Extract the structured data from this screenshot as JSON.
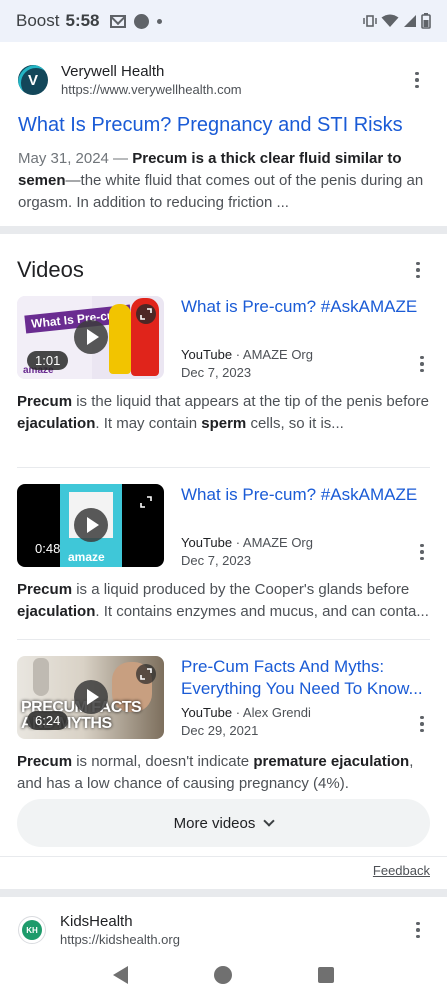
{
  "status_bar": {
    "carrier": "Boost",
    "time": "5:58",
    "icons_left": [
      "gmail-icon",
      "dot-icon",
      "small-dot-icon"
    ],
    "icons_right": [
      "vibrate-icon",
      "wifi-icon",
      "signal-icon",
      "battery-icon"
    ]
  },
  "result": {
    "site_name": "Verywell Health",
    "site_url": "https://www.verywellhealth.com",
    "logo_letter": "V",
    "title": "What Is Precum? Pregnancy and STI Risks",
    "date": "May 31, 2024 — ",
    "snippet_bold": "Precum is a thick clear fluid similar to semen",
    "snippet_rest": "—the white fluid that comes out of the penis during an orgasm. In addition to reducing friction ..."
  },
  "videos": {
    "heading": "Videos",
    "items": [
      {
        "title": "What is Pre-cum? #AskAMAZE",
        "duration": "1:01",
        "thumb_text": "What Is Pre-cum",
        "thumb_brand": "amaze",
        "source": "YouTube",
        "channel": " · AMAZE Org",
        "date": "Dec 7, 2023",
        "desc_parts": [
          "Precum",
          " is the liquid that appears at the tip of the penis before ",
          "ejaculation",
          ". It may contain ",
          "sperm",
          " cells, so it is..."
        ]
      },
      {
        "title": "What is Pre-cum? #AskAMAZE",
        "duration": "0:48",
        "thumb_text": "",
        "thumb_brand": "amaze",
        "source": "YouTube",
        "channel": " · AMAZE Org",
        "date": "Dec 7, 2023",
        "desc_parts": [
          "Precum",
          " is a liquid produced by the Cooper's glands before ",
          "ejaculation",
          ". It contains enzymes and mucus, and can conta...",
          "",
          ""
        ]
      },
      {
        "title": "Pre-Cum Facts And Myths: Everything You Need To Know...",
        "duration": "6:24",
        "thumb_text": "PRECUM FACTS AND MYTHS",
        "thumb_brand": "",
        "source": "YouTube",
        "channel": " · Alex Grendi",
        "date": "Dec 29, 2021",
        "desc_parts": [
          "Precum",
          " is normal, doesn't indicate ",
          "premature ejaculation",
          ", and has a low chance of causing pregnancy (4%).",
          "",
          ""
        ]
      }
    ],
    "more_button": "More videos"
  },
  "feedback": "Feedback",
  "next_result": {
    "site_name": "KidsHealth",
    "site_url": "https://kidshealth.org",
    "logo_letters": "KH"
  },
  "nav_bar": {
    "icons": [
      "back-icon",
      "home-icon",
      "recents-icon"
    ]
  }
}
